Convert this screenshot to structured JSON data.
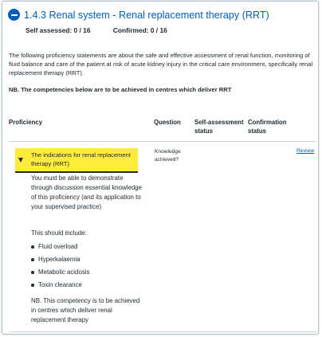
{
  "section": {
    "title": "1.4.3 Renal system - Renal replacement therapy (RRT)",
    "self_assessed": "Self assessed: 0 / 16",
    "confirmed": "Confirmed: 0 / 16",
    "intro": "The following proficiency statements are about the safe and effective assessment of renal function, monitoring of fluid balance and care of the patient at risk of acute kidney injury in the critical care environment, specifically renal replacement therapy (RRT).",
    "nb": "NB. The competencies below are to be achieved in centres which deliver RRT"
  },
  "table": {
    "headers": {
      "proficiency": "Proficiency",
      "question": "Question",
      "self_assessment_1": "Self-assessment",
      "self_assessment_2": "status",
      "confirmation_1": "Confirmation",
      "confirmation_2": "status"
    },
    "row": {
      "title": "The indications for renal replacement therapy (RRT)",
      "question_1": "Knowledge",
      "question_2": "achieved?",
      "review": "Review",
      "description": "You must be able to demonstrate through discussion essential knowledge of this proficiency (and its application to your supervised practice)",
      "include_label": "This should include:",
      "items": [
        "Fluid overload",
        "Hyperkalaemia",
        "Metabolic acidosis",
        "Toxin clearance"
      ],
      "nb": "NB. This competency is to be achieved in centres which deliver renal replacement therapy"
    }
  },
  "colors": {
    "accent": "#005eb8",
    "highlight": "#ffeb3b",
    "text": "#212b32"
  }
}
